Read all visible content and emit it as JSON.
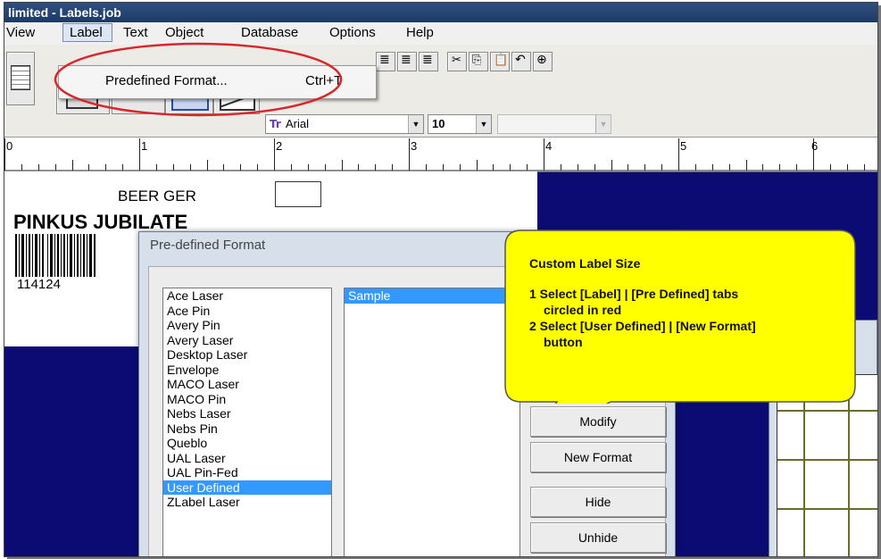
{
  "window": {
    "title": "limited - Labels.job"
  },
  "menubar": {
    "items": [
      "View",
      "Label",
      "Text",
      "Object",
      "Database",
      "Options",
      "Help"
    ]
  },
  "dropdown": {
    "item_label": "Predefined Format...",
    "item_shortcut": "Ctrl+T"
  },
  "toolbar": {
    "font_name": "Arial",
    "font_size": "10"
  },
  "ruler": {
    "numbers": [
      "0",
      "1",
      "2",
      "3",
      "4",
      "5",
      "6"
    ]
  },
  "label": {
    "line1": "BEER GER",
    "line2": "PINKUS JUBILATE",
    "barcode_number": "114124"
  },
  "dialog": {
    "title": "Pre-defined Format",
    "formats": [
      "Ace Laser",
      "Ace Pin",
      "Avery Pin",
      "Avery Laser",
      "Desktop Laser",
      "Envelope",
      "MACO Laser",
      "MACO Pin",
      "Nebs Laser",
      "Nebs Pin",
      "Queblo",
      "UAL Laser",
      "UAL Pin-Fed",
      "User Defined",
      "ZLabel Laser"
    ],
    "selected_format": "User Defined",
    "sample_item": "Sample",
    "buttons": {
      "modify": "Modify",
      "new_format": "New Format",
      "hide": "Hide",
      "unhide": "Unhide"
    }
  },
  "callout": {
    "title": "Custom Label Size",
    "step1_line1": "1 Select [Label] | [Pre Defined] tabs",
    "step1_line2": "circled in red",
    "step2_line1": "2 Select [User Defined] | [New Format]",
    "step2_line2": "button"
  },
  "colors": {
    "annotation_red": "#d9262c",
    "callout_fill": "#ffff00",
    "selection": "#3399ff",
    "workspace": "#0b0b73"
  }
}
